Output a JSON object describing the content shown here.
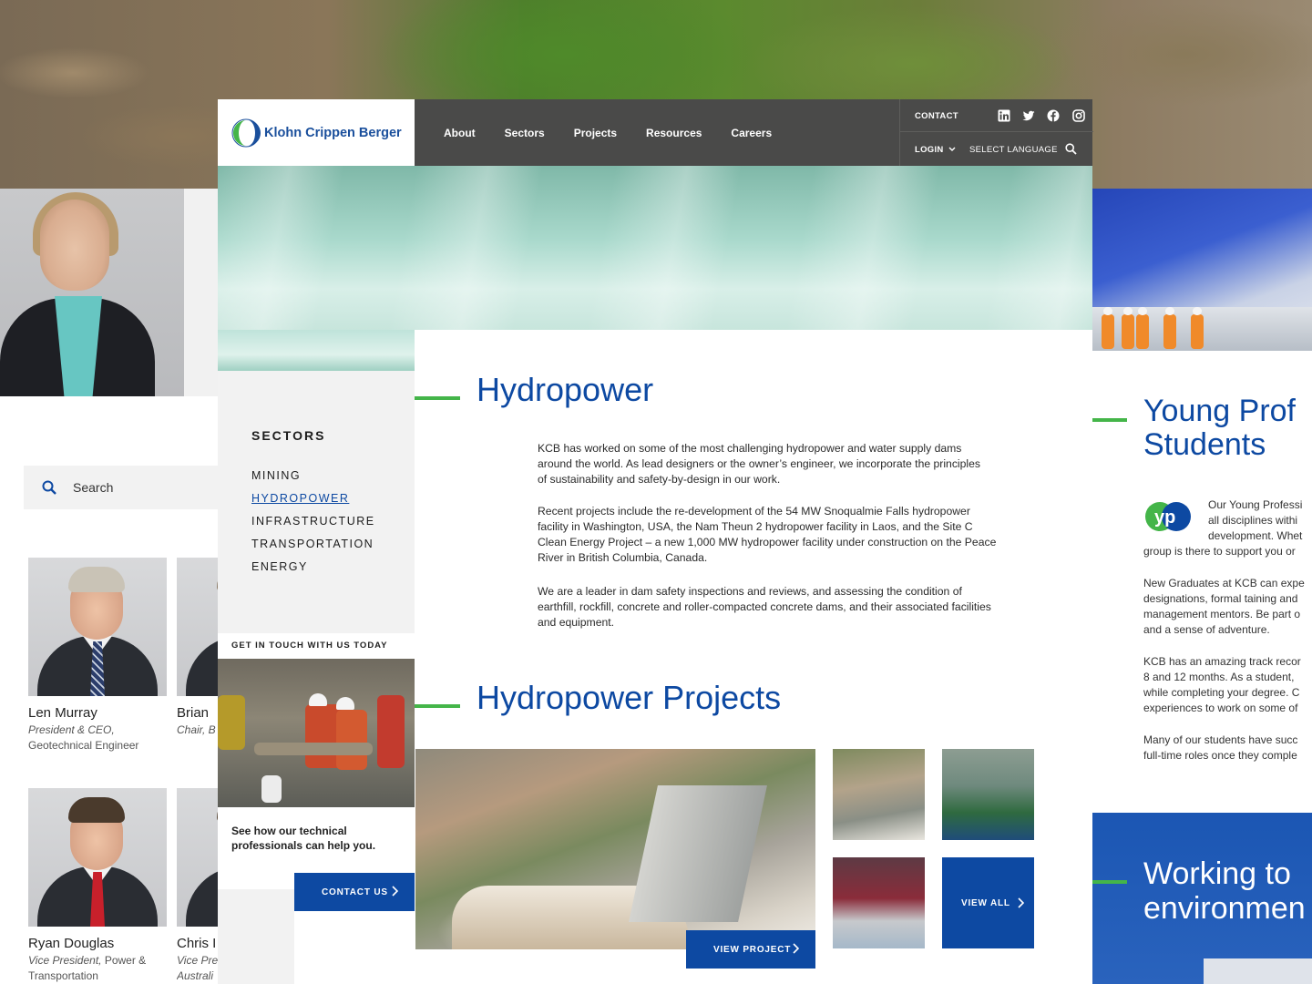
{
  "brand": {
    "name": "Klohn Crippen Berger",
    "accent_blue": "#0d49a2",
    "accent_green": "#44b549",
    "header_bg": "#4a4a49"
  },
  "header": {
    "nav": [
      "About",
      "Sectors",
      "Projects",
      "Resources",
      "Careers"
    ],
    "contact": "CONTACT",
    "login": "LOGIN",
    "language": "SELECT LANGUAGE",
    "social_icons": [
      "linkedin-icon",
      "twitter-icon",
      "facebook-icon",
      "instagram-icon"
    ]
  },
  "sidebar": {
    "title": "SECTORS",
    "items": [
      "MINING",
      "HYDROPOWER",
      "INFRASTRUCTURE",
      "TRANSPORTATION",
      "ENERGY"
    ],
    "active": "HYDROPOWER"
  },
  "get_in_touch": {
    "heading": "GET IN TOUCH WITH US TODAY",
    "text": "See how our technical\nprofessionals can help you.",
    "button": "CONTACT US"
  },
  "main": {
    "title": "Hydropower",
    "paragraphs": [
      "KCB has worked on some of the most challenging hydropower and water supply dams\naround the world. As lead designers or the owner’s engineer, we incorporate the principles\nof sustainability and safety-by-design in our work.",
      "Recent projects include the re-development of the 54 MW Snoqualmie Falls hydropower\nfacility in Washington, USA, the Nam Theun 2 hydropower facility in Laos, and the Site C\nClean Energy Project – a new 1,000 MW hydropower facility under construction on the Peace\nRiver in British Columbia, Canada.",
      "We are a leader in dam safety inspections and reviews, and assessing the condition of\nearthfill, rockfill, concrete and roller-compacted concrete dams, and their associated facilities\nand equipment."
    ],
    "projects_title": "Hydropower Projects",
    "view_project": "VIEW PROJECT",
    "view_all": "VIEW ALL"
  },
  "left_page": {
    "search_placeholder": "Search",
    "people": [
      {
        "name": "Len Murray",
        "role_title": "President & CEO,",
        "role_sub": "Geotechnical Engineer"
      },
      {
        "name": "Brian",
        "role_title": "Chair, B",
        "role_sub": ""
      },
      {
        "name": "Ryan Douglas",
        "role_title": "Vice President,",
        "role_tail": " Power &",
        "role_sub": "Transportation"
      },
      {
        "name": "Chris I",
        "role_title": "Vice Pre",
        "role_sub": "Australi"
      }
    ]
  },
  "right_page": {
    "title": "Young Prof\nStudents",
    "para1": "Our Young Professi\nall disciplines withi\ndevelopment. Whet",
    "para1_last": "group is there to support you or",
    "para2": "New Graduates at KCB can expe\ndesignations, formal taining and\nmanagement mentors. Be part o\nand a sense of adventure.",
    "para3": "KCB has an amazing track recor\n8 and 12 months. As a student,\nwhile completing your degree. C\nexperiences to work on some of",
    "para4": "Many of our students have succ\nfull-time roles once they comple",
    "banner": "Working to\nenvironmen"
  }
}
